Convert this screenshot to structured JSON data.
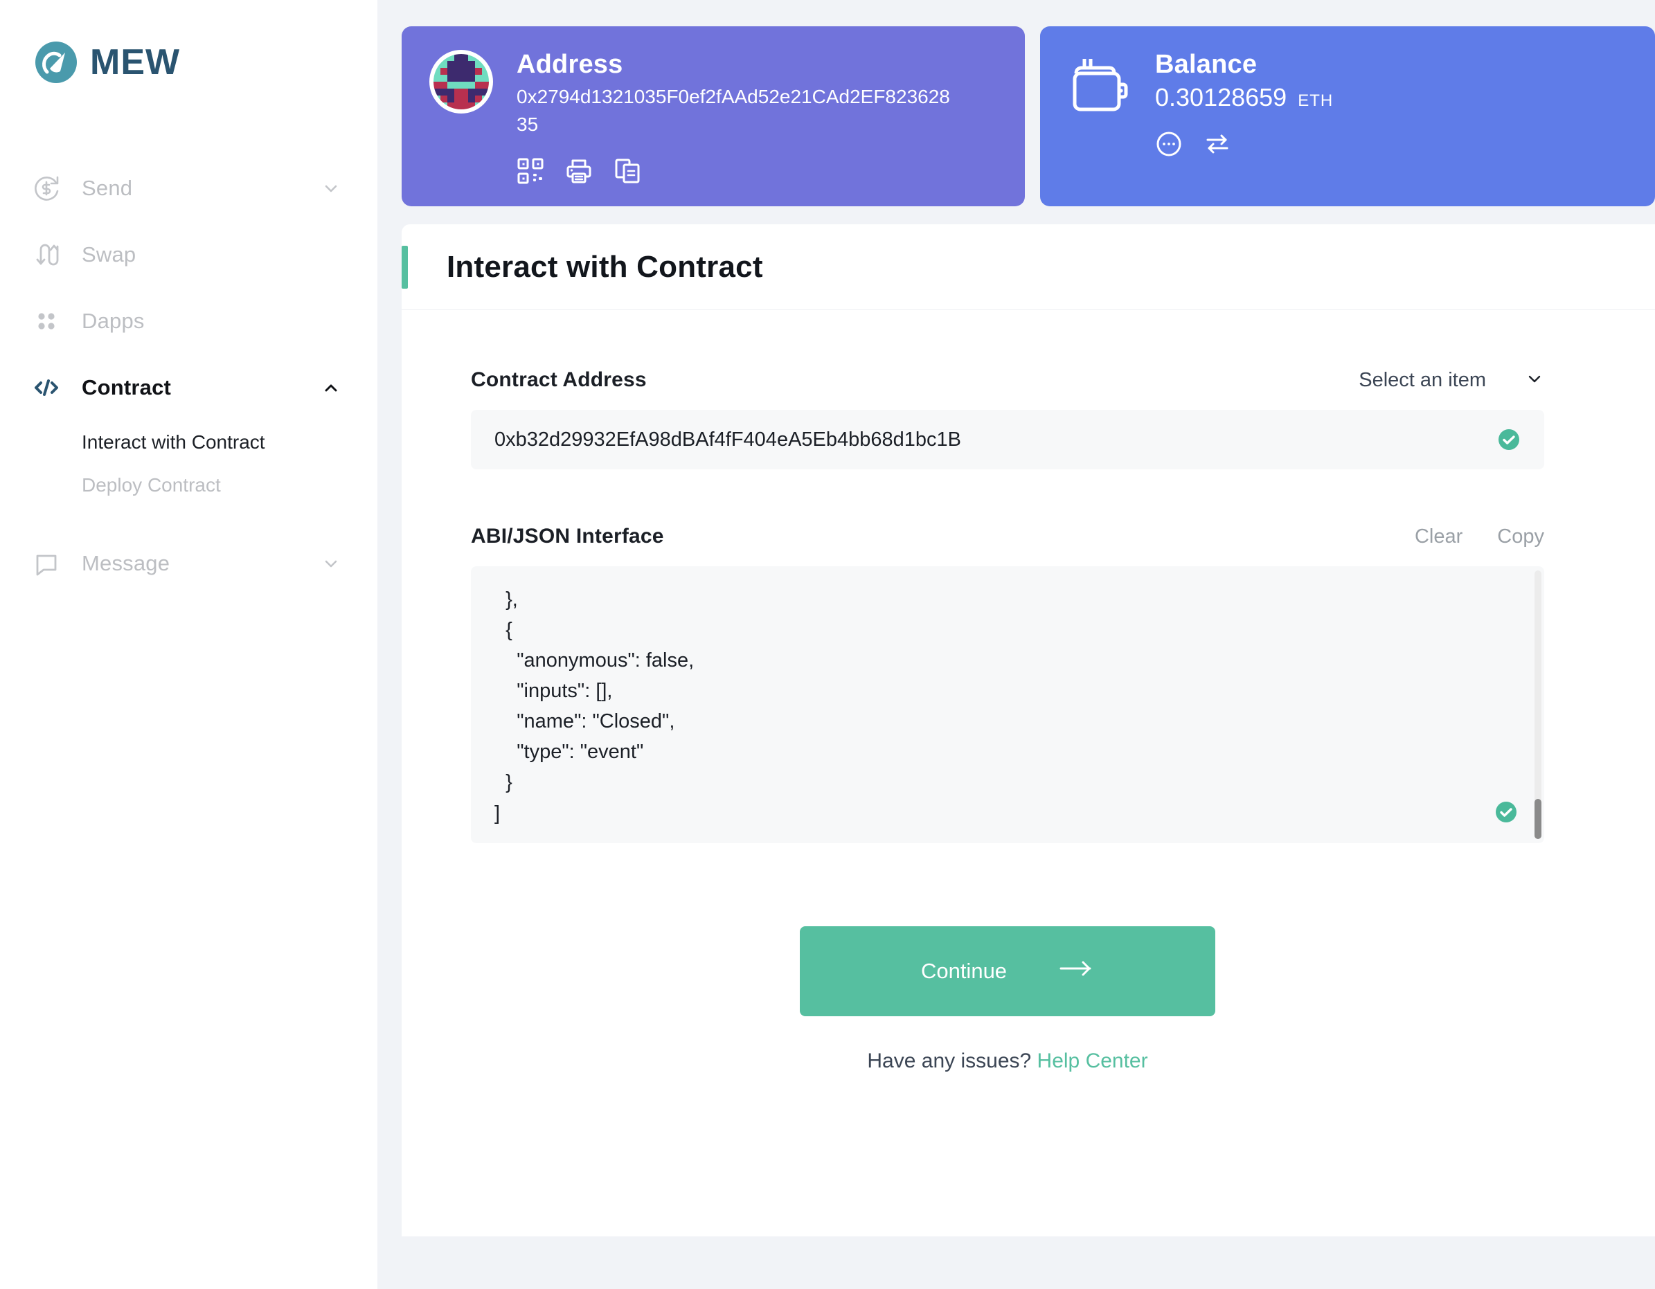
{
  "brand": {
    "name": "MEW",
    "logo_icon": "mew-logo-icon",
    "logo_color": "#4a9aac",
    "wordmark_color": "#2a5470"
  },
  "sidebar": {
    "items": [
      {
        "label": "Send",
        "icon": "send-circle-dollar-icon",
        "state": "muted",
        "chevron": "chevron-down-icon"
      },
      {
        "label": "Swap",
        "icon": "swap-arrows-icon",
        "state": "muted",
        "chevron": ""
      },
      {
        "label": "Dapps",
        "icon": "dapps-dots-icon",
        "state": "muted",
        "chevron": ""
      },
      {
        "label": "Contract",
        "icon": "code-brackets-icon",
        "state": "active",
        "chevron": "chevron-up-icon"
      },
      {
        "label": "Message",
        "icon": "message-bubble-icon",
        "state": "muted",
        "chevron": "chevron-down-icon"
      }
    ],
    "contract_children": [
      {
        "label": "Interact with Contract",
        "state": "selected"
      },
      {
        "label": "Deploy Contract",
        "state": "disabled"
      }
    ]
  },
  "address_card": {
    "title": "Address",
    "value": "0x2794d1321035F0ef2fAAd52e21CAd2EF82362835",
    "bg_color": "#7173db",
    "avatar_icon": "blockie-avatar",
    "actions": [
      {
        "icon": "qr-code-icon"
      },
      {
        "icon": "print-icon"
      },
      {
        "icon": "copy-icon"
      }
    ]
  },
  "balance_card": {
    "title": "Balance",
    "amount": "0.30128659",
    "unit": "ETH",
    "bg_color": "#5f7ce8",
    "wallet_icon": "wallet-icon",
    "actions": [
      {
        "icon": "more-options-icon"
      },
      {
        "icon": "exchange-arrows-icon"
      }
    ]
  },
  "panel": {
    "title": "Interact with Contract",
    "accent_color": "#56bfa0",
    "contract_address": {
      "label": "Contract Address",
      "select_placeholder": "Select an item",
      "chevron_icon": "chevron-down-icon",
      "value": "0xb32d29932EfA98dBAf4fF404eA5Eb4bb68d1bc1B",
      "valid_icon": "check-circle-icon",
      "valid_color": "#4ab99a"
    },
    "abi": {
      "label": "ABI/JSON Interface",
      "clear_label": "Clear",
      "copy_label": "Copy",
      "content": "  },\n  {\n    \"anonymous\": false,\n    \"inputs\": [],\n    \"name\": \"Closed\",\n    \"type\": \"event\"\n  }\n]",
      "valid_icon": "check-circle-icon",
      "scrollbar": "vertical-scrollbar"
    },
    "cta": {
      "label": "Continue",
      "icon": "arrow-right-icon",
      "color": "#56bfa0"
    },
    "footer": {
      "text": "Have any issues?",
      "link_label": "Help Center",
      "link_color": "#56bfa0"
    }
  }
}
